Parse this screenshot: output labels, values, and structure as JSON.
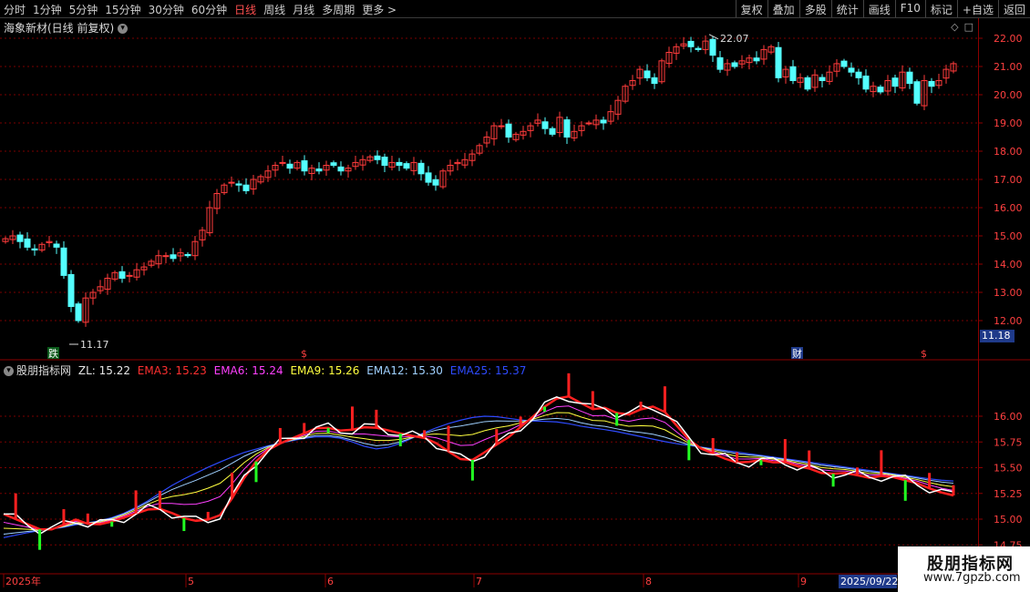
{
  "toolbar": {
    "periods": [
      "分时",
      "1分钟",
      "5分钟",
      "15分钟",
      "30分钟",
      "60分钟",
      "日线",
      "周线",
      "月线",
      "多周期",
      "更多 >"
    ],
    "active_period": "日线",
    "actions": [
      "复权",
      "叠加",
      "多股",
      "统计",
      "画线",
      "F10",
      "标记",
      "+自选",
      "返回"
    ]
  },
  "stock": {
    "title": "海象新材(日线 前复权)"
  },
  "price_axis": {
    "ticks": [
      "22.00",
      "21.00",
      "20.00",
      "19.00",
      "18.00",
      "17.00",
      "16.00",
      "15.00",
      "14.00",
      "13.00",
      "12.00"
    ],
    "current_badge": "11.18"
  },
  "annotations": {
    "high_label": "22.07",
    "low_label": "11.17"
  },
  "markers": {
    "m1": "跌",
    "m2": "$",
    "m3": "财",
    "m4": "$"
  },
  "indicator": {
    "name": "股朋指标网",
    "items": [
      {
        "label": "ZL: 15.22",
        "color": "#e8e8e8"
      },
      {
        "label": "EMA3: 15.23",
        "color": "#ff3030"
      },
      {
        "label": "EMA6: 15.24",
        "color": "#ff40ff"
      },
      {
        "label": "EMA9: 15.26",
        "color": "#ffff40"
      },
      {
        "label": "EMA12: 15.30",
        "color": "#9fd0ff"
      },
      {
        "label": "EMA25: 15.37",
        "color": "#2e4bff"
      }
    ],
    "ticks": [
      "16.00",
      "15.75",
      "15.50",
      "15.25",
      "15.00",
      "14.75"
    ]
  },
  "time_axis": {
    "labels": [
      "2025年",
      "5",
      "6",
      "7",
      "8",
      "9"
    ],
    "cursor_date": "2025/09/22"
  },
  "watermark": {
    "title": "股朋指标网",
    "url": "www.7gpzb.com"
  },
  "colors": {
    "up": "#ff3b3b",
    "down": "#54ffff",
    "grid": "#7a0000",
    "axis": "#8b0000"
  },
  "chart_data": {
    "type": "candlestick",
    "price_range": [
      11.5,
      22.5
    ],
    "high": 22.07,
    "low": 11.17,
    "indicator_range": [
      14.75,
      16.25
    ],
    "closes": [
      14.9,
      15.0,
      14.8,
      14.6,
      14.5,
      14.7,
      14.8,
      14.6,
      13.6,
      12.5,
      12.0,
      12.8,
      13.0,
      13.2,
      13.5,
      13.7,
      13.5,
      13.6,
      13.8,
      13.9,
      14.1,
      14.3,
      14.3,
      14.2,
      14.4,
      14.3,
      14.8,
      15.2,
      16.0,
      16.5,
      16.8,
      16.9,
      16.8,
      16.6,
      17.0,
      17.1,
      17.3,
      17.5,
      17.6,
      17.4,
      17.6,
      17.3,
      17.4,
      17.3,
      17.5,
      17.5,
      17.3,
      17.4,
      17.6,
      17.7,
      17.8,
      17.7,
      17.5,
      17.6,
      17.5,
      17.4,
      17.6,
      17.2,
      16.9,
      16.8,
      17.3,
      17.5,
      17.6,
      17.7,
      17.9,
      18.2,
      18.5,
      18.9,
      18.9,
      18.5,
      18.6,
      18.7,
      18.9,
      19.1,
      18.8,
      18.6,
      19.2,
      18.5,
      18.7,
      18.9,
      19.0,
      19.1,
      19.0,
      19.4,
      19.8,
      20.3,
      20.5,
      20.9,
      20.6,
      20.4,
      21.2,
      21.5,
      21.7,
      21.8,
      21.7,
      21.6,
      21.9,
      21.4,
      20.9,
      21.1,
      21.0,
      21.2,
      21.3,
      21.2,
      21.6,
      21.7,
      20.6,
      20.9,
      20.5,
      20.6,
      20.2,
      20.7,
      20.5,
      20.8,
      21.1,
      21.0,
      20.8,
      20.6,
      20.2,
      20.3,
      20.1,
      20.5,
      20.3,
      20.8,
      20.4,
      19.7,
      20.5,
      20.3,
      20.5,
      20.9,
      21.1
    ],
    "ema3": [
      15.05,
      15.0,
      14.95,
      14.9,
      14.9,
      14.95,
      15.0,
      14.95,
      14.95,
      14.98,
      15.02,
      15.06,
      15.1,
      15.1,
      15.05,
      15.0,
      14.98,
      15.0,
      15.05,
      15.25,
      15.45,
      15.6,
      15.7,
      15.75,
      15.8,
      15.85,
      15.9,
      15.88,
      15.85,
      15.88,
      15.9,
      15.88,
      15.85,
      15.82,
      15.8,
      15.78,
      15.7,
      15.62,
      15.55,
      15.6,
      15.7,
      15.75,
      15.85,
      15.95,
      16.05,
      16.15,
      16.2,
      16.18,
      16.05,
      16.1,
      16.05,
      16.0,
      16.05,
      16.1,
      16.08,
      15.95,
      15.8,
      15.7,
      15.65,
      15.6,
      15.55,
      15.55,
      15.58,
      15.55,
      15.56,
      15.52,
      15.5,
      15.45,
      15.44,
      15.45,
      15.43,
      15.4,
      15.42,
      15.41,
      15.38,
      15.35,
      15.3,
      15.26,
      15.23
    ],
    "ema25": [
      14.82,
      14.85,
      14.88,
      14.9,
      14.92,
      14.95,
      14.97,
      15.0,
      15.05,
      15.12,
      15.2,
      15.3,
      15.38,
      15.45,
      15.52,
      15.58,
      15.64,
      15.68,
      15.72,
      15.75,
      15.78,
      15.8,
      15.8,
      15.78,
      15.72,
      15.68,
      15.7,
      15.75,
      15.82,
      15.88,
      15.93,
      15.97,
      16.0,
      16.0,
      15.98,
      15.96,
      15.95,
      15.95,
      15.93,
      15.9,
      15.88,
      15.86,
      15.83,
      15.8,
      15.77,
      15.74,
      15.72,
      15.7,
      15.68,
      15.66,
      15.64,
      15.62,
      15.6,
      15.58,
      15.56,
      15.54,
      15.52,
      15.5,
      15.48,
      15.46,
      15.44,
      15.42,
      15.4,
      15.38,
      15.37
    ]
  }
}
